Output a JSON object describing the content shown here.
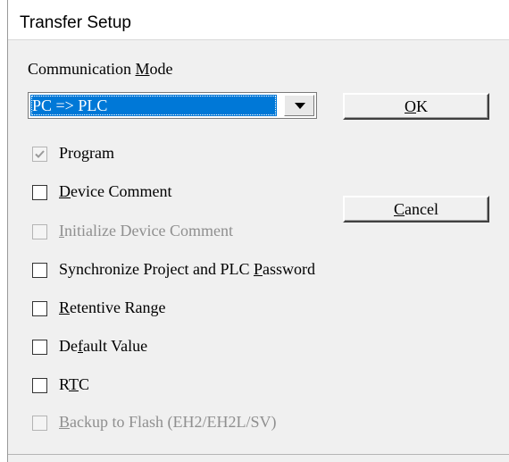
{
  "window": {
    "title": "Transfer Setup"
  },
  "communication": {
    "label_before": "Communication ",
    "label_key": "M",
    "label_after": "ode",
    "selected": "PC => PLC"
  },
  "buttons": {
    "ok": {
      "key": "O",
      "rest": "K"
    },
    "cancel": {
      "key": "C",
      "rest": "ancel"
    }
  },
  "options": [
    {
      "pre": "",
      "key": "",
      "post": "Program",
      "checked": true,
      "enabled": false
    },
    {
      "pre": "",
      "key": "D",
      "post": "evice Comment",
      "checked": false,
      "enabled": true
    },
    {
      "pre": "",
      "key": "I",
      "post": "nitialize Device Comment",
      "checked": false,
      "enabled": false
    },
    {
      "pre": "Synchronize Project and PLC ",
      "key": "P",
      "post": "assword",
      "checked": false,
      "enabled": true
    },
    {
      "pre": "",
      "key": "R",
      "post": "etentive Range",
      "checked": false,
      "enabled": true
    },
    {
      "pre": "De",
      "key": "f",
      "post": "ault Value",
      "checked": false,
      "enabled": true
    },
    {
      "pre": "R",
      "key": "T",
      "post": "C",
      "checked": false,
      "enabled": true
    },
    {
      "pre": "",
      "key": "B",
      "post": "ackup to Flash (EH2/EH2L/SV)",
      "checked": false,
      "enabled": false
    }
  ]
}
